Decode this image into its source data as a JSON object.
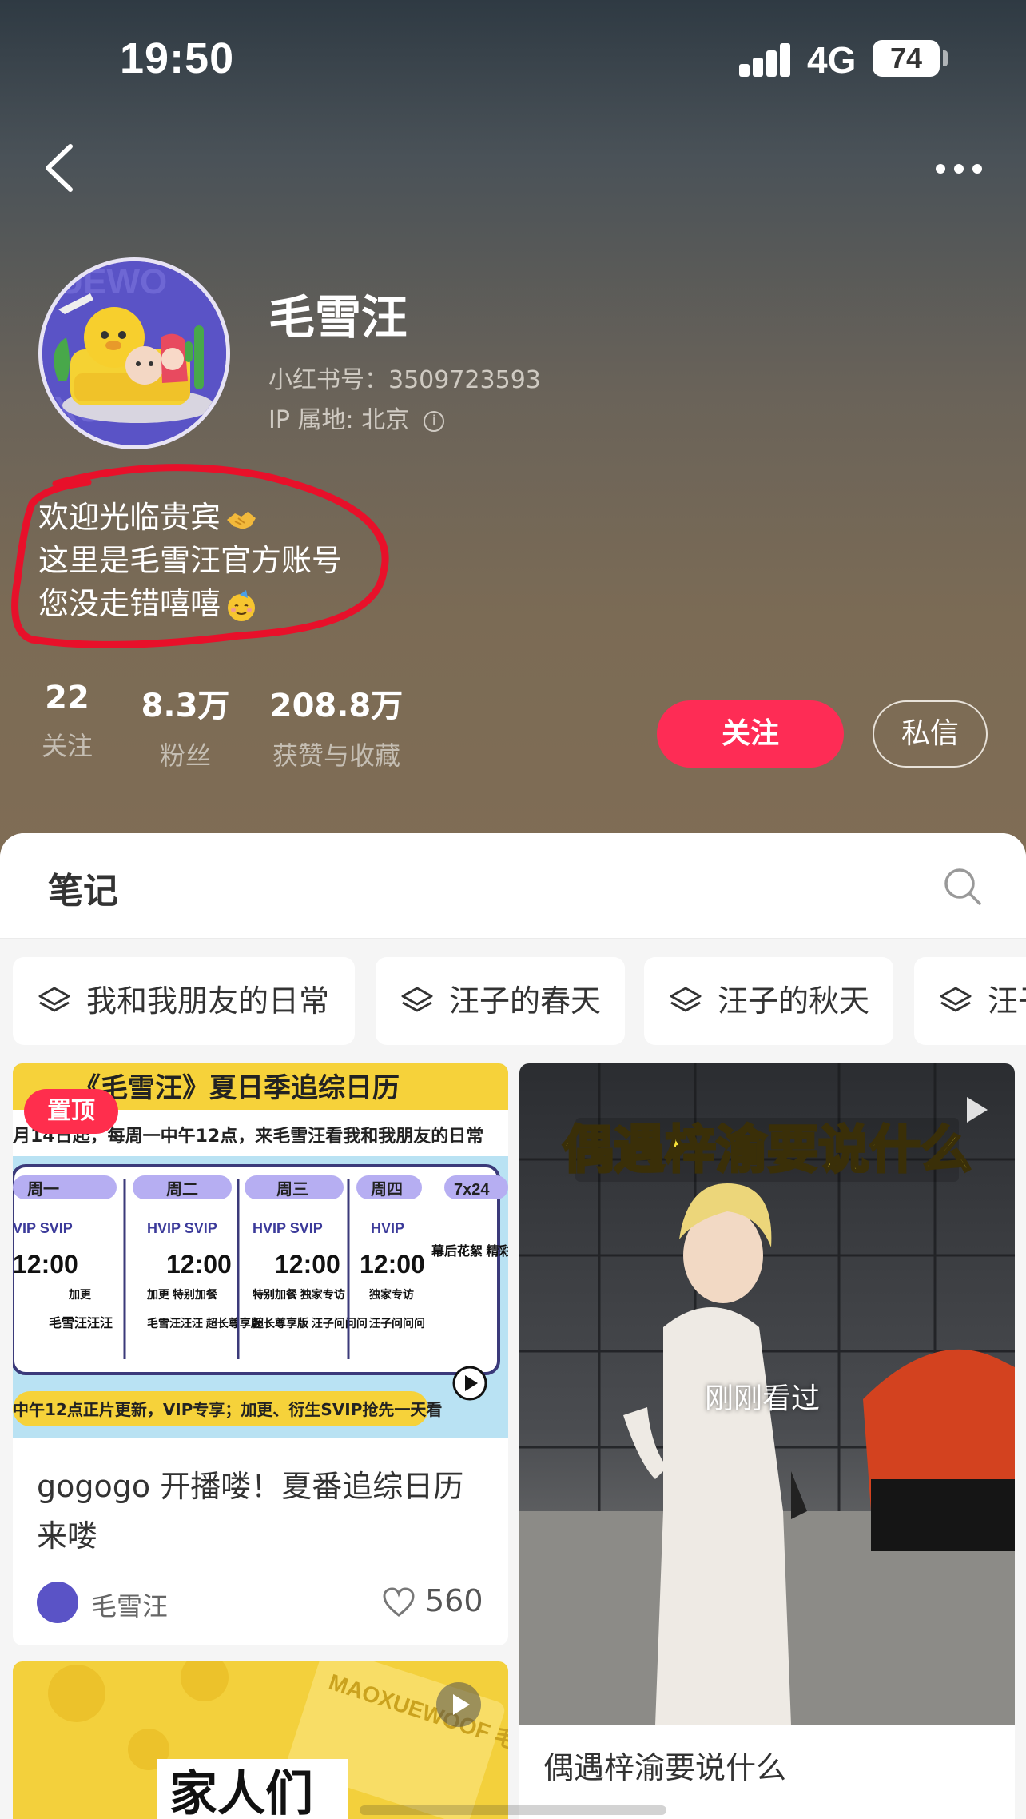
{
  "status_bar": {
    "time": "19:50",
    "network": "4G",
    "battery": "74"
  },
  "profile": {
    "name": "毛雪汪",
    "redbook_id": "小红书号：3509723593",
    "ip_location": "IP 属地: 北京",
    "bio": [
      "欢迎光临贵宾",
      "这里是毛雪汪官方账号",
      "您没走错嘻嘻"
    ],
    "stats": [
      {
        "value": "22",
        "label": "关注"
      },
      {
        "value": "8.3万",
        "label": "粉丝"
      },
      {
        "value": "208.8万",
        "label": "获赞与收藏"
      }
    ],
    "follow_label": "关注",
    "message_label": "私信"
  },
  "notes": {
    "tab_label": "笔记",
    "collections": [
      "我和我朋友的日常",
      "汪子的春天",
      "汪子的秋天",
      "汪子"
    ],
    "cards": [
      {
        "pinned_label": "置顶",
        "cover_title": "《毛雪汪》夏日季追综日历",
        "cover_subtitle": "月14日起，每周一中午12点，来毛雪汪看我和我朋友的日常",
        "cover_footer": "中午12点正片更新，VIP专享；加更、衍生SVIP抢先一天看",
        "schedule": [
          {
            "day": "周一",
            "tags": "VIP  SVIP",
            "time": "12:00",
            "note": "加更",
            "show": "毛雪汪汪汪"
          },
          {
            "day": "周二",
            "tags": "HVIP  SVIP",
            "time": "12:00",
            "note": "加更  特别加餐",
            "show": "毛雪汪汪汪  超长尊享版"
          },
          {
            "day": "周三",
            "tags": "HVIP  SVIP",
            "time": "12:00",
            "note": "特别加餐  独家专访",
            "show": "超长尊享版  汪子问问问"
          },
          {
            "day": "周四",
            "tags": "HVIP",
            "time": "12:00",
            "note": "独家专访",
            "show": "汪子问问问"
          },
          {
            "day": "7x24",
            "tags": "",
            "time": "",
            "note": "",
            "show": "幕后花絮 精彩短片 不定期"
          }
        ],
        "title": "gogogo 开播喽！夏番追综日历来喽",
        "author": "毛雪汪",
        "likes": "560"
      },
      {
        "cover_title": "偶遇梓渝要说什么",
        "viewed_label": "刚刚看过",
        "title": "偶遇梓渝要说什么"
      },
      {
        "cover_title": "家人们",
        "watermark": "MAOXUEWOOF 毛雪汪"
      }
    ]
  },
  "colors": {
    "accent": "#fe2c55",
    "annotation": "#e8102a"
  }
}
